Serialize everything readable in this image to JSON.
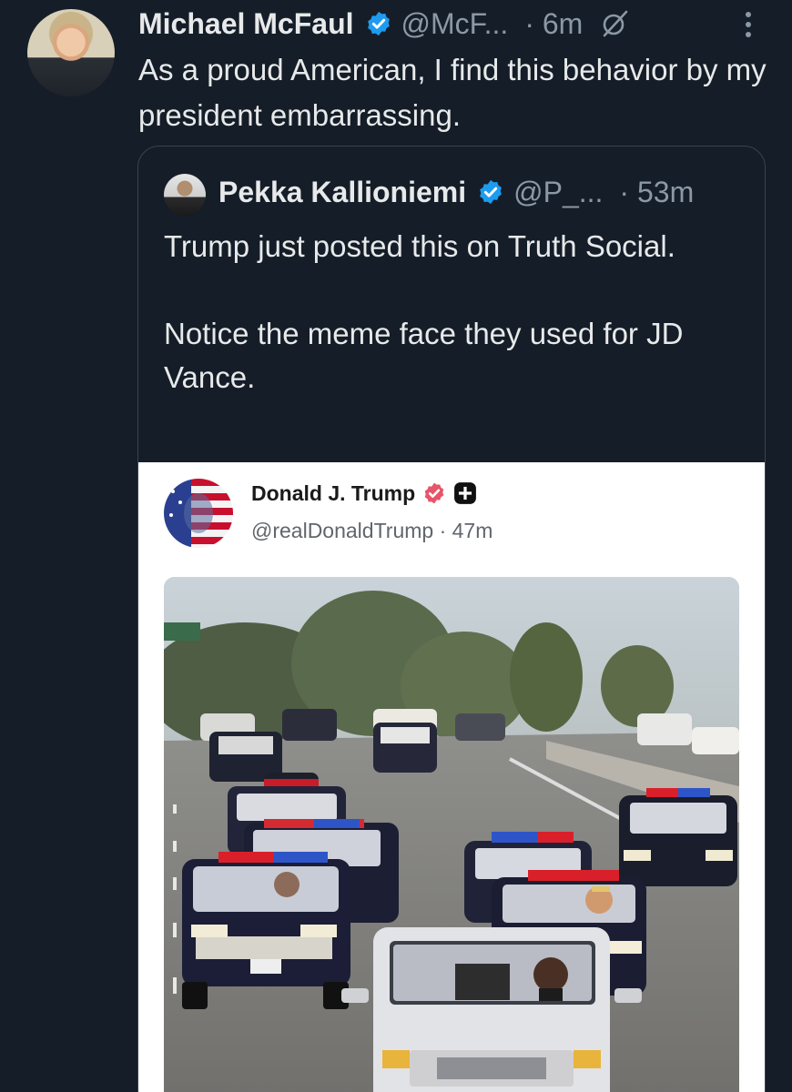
{
  "tweet": {
    "author_name": "Michael McFaul",
    "handle": "@McF...",
    "time": "· 6m",
    "text": "As a proud American, I find this behavior by my president embarrassing."
  },
  "quote": {
    "author_name": "Pekka Kallioniemi",
    "handle": "@P_...",
    "time": "· 53m",
    "paragraph1": "Trump just posted this on Truth Social.",
    "paragraph2": "Notice the meme face they used for JD Vance."
  },
  "embedded_post": {
    "author_name": "Donald J. Trump",
    "handle_time": "@realDonaldTrump · 47m"
  },
  "colors": {
    "background": "#151d28",
    "verified_blue": "#1d9bf0",
    "truth_badge": "#e8546a",
    "muted_text": "#8b98a5"
  },
  "icons": [
    "verified-badge-icon",
    "grok-icon",
    "more-options-icon",
    "truth-verified-icon",
    "truth-plus-icon"
  ]
}
